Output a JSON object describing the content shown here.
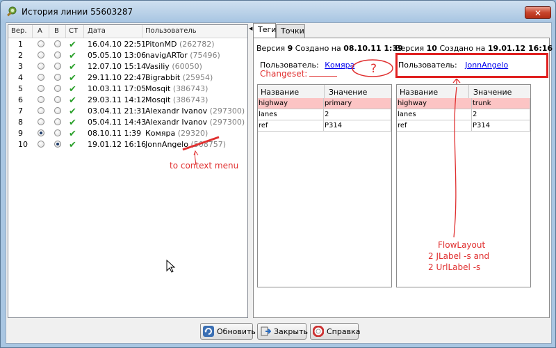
{
  "window": {
    "title": "История линии 55603287",
    "close_label": "✕"
  },
  "history": {
    "columns": [
      "Вер.",
      "A",
      "B",
      "CT",
      "Дата",
      "Пользователь"
    ],
    "rows": [
      {
        "ver": "1",
        "date": "16.04.10 22:51",
        "user": "PitonMD",
        "uid": "(262782)",
        "a": false,
        "b": false
      },
      {
        "ver": "2",
        "date": "05.05.10 13:06",
        "user": "navigARTor",
        "uid": "(75496)",
        "a": false,
        "b": false
      },
      {
        "ver": "3",
        "date": "12.07.10 15:14",
        "user": "Vasiliy",
        "uid": "(60050)",
        "a": false,
        "b": false
      },
      {
        "ver": "4",
        "date": "29.11.10 22:47",
        "user": "Bigrabbit",
        "uid": "(25954)",
        "a": false,
        "b": false
      },
      {
        "ver": "5",
        "date": "10.03.11 17:05",
        "user": "Mosqit",
        "uid": "(386743)",
        "a": false,
        "b": false
      },
      {
        "ver": "6",
        "date": "29.03.11 14:12",
        "user": "Mosqit",
        "uid": "(386743)",
        "a": false,
        "b": false
      },
      {
        "ver": "7",
        "date": "03.04.11 21:31",
        "user": "Alexandr Ivanov",
        "uid": "(297300)",
        "a": false,
        "b": false
      },
      {
        "ver": "8",
        "date": "05.04.11 14:43",
        "user": "Alexandr Ivanov",
        "uid": "(297300)",
        "a": false,
        "b": false
      },
      {
        "ver": "9",
        "date": "08.10.11 1:39",
        "user": "Комяра",
        "uid": "(29320)",
        "a": true,
        "b": false
      },
      {
        "ver": "10",
        "date": "19.01.12 16:16",
        "user": "JonnAngelo",
        "uid": "(508757)",
        "a": false,
        "b": true
      }
    ]
  },
  "tabs": [
    "Теги",
    "Точки"
  ],
  "left_version": {
    "prefix": "Версия",
    "num": "9",
    "mid": "Создано на",
    "date": "08.10.11 1:39",
    "user_label": "Пользователь:",
    "user": "Комяра"
  },
  "right_version": {
    "prefix": "Версия",
    "num": "10",
    "mid": "Создано на",
    "date": "19.01.12 16:16",
    "user_label": "Пользователь:",
    "user": "JonnAngelo"
  },
  "tag_columns": [
    "Название",
    "Значение"
  ],
  "left_tags": [
    {
      "key": "highway",
      "value": "primary",
      "changed": true
    },
    {
      "key": "lanes",
      "value": "2",
      "changed": false
    },
    {
      "key": "ref",
      "value": "P314",
      "changed": false
    }
  ],
  "right_tags": [
    {
      "key": "highway",
      "value": "trunk",
      "changed": true
    },
    {
      "key": "lanes",
      "value": "2",
      "changed": false
    },
    {
      "key": "ref",
      "value": "P314",
      "changed": false
    }
  ],
  "annotations": {
    "changeset": "Changeset:",
    "question": "?",
    "context_menu": "to context menu",
    "flowlayout": [
      "FlowLayout",
      "2 JLabel -s and",
      "2 UrlLabel -s"
    ]
  },
  "buttons": {
    "refresh": "Обновить",
    "close": "Закрыть",
    "help": "Справка"
  },
  "colors": {
    "changed_row": "#fcc4c4",
    "annotation": "#e03030",
    "link": "#0000ee"
  }
}
